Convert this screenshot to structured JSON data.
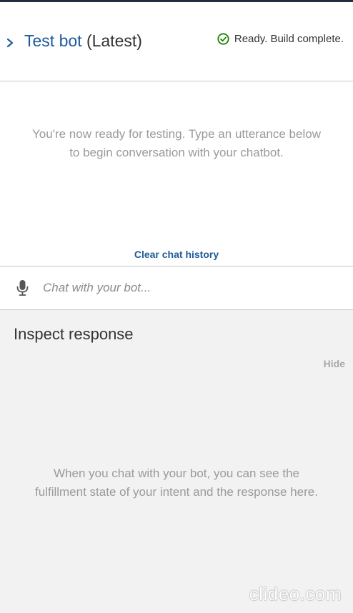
{
  "header": {
    "title_bot": "Test bot",
    "title_version": "(Latest)",
    "status_text": "Ready. Build complete."
  },
  "intro": {
    "line1": "You're now ready for testing. Type an utterance below",
    "line2": "to begin conversation with your chatbot."
  },
  "clear_chat_label": "Clear chat history",
  "chat": {
    "placeholder": "Chat with your bot...",
    "value": ""
  },
  "inspect": {
    "title": "Inspect response",
    "hide_label": "Hide",
    "line1": "When you chat with your bot, you can see the",
    "line2": "fulfillment state of your intent and the response here."
  },
  "watermark": "clideo.com",
  "icons": {
    "expand": "chevron-right-icon",
    "status": "check-circle-icon",
    "mic": "microphone-icon"
  },
  "colors": {
    "link_blue": "#1f5b99",
    "status_green": "#1d8102",
    "muted_text": "#9a9a9a",
    "panel_bg": "#f2f2f2"
  }
}
